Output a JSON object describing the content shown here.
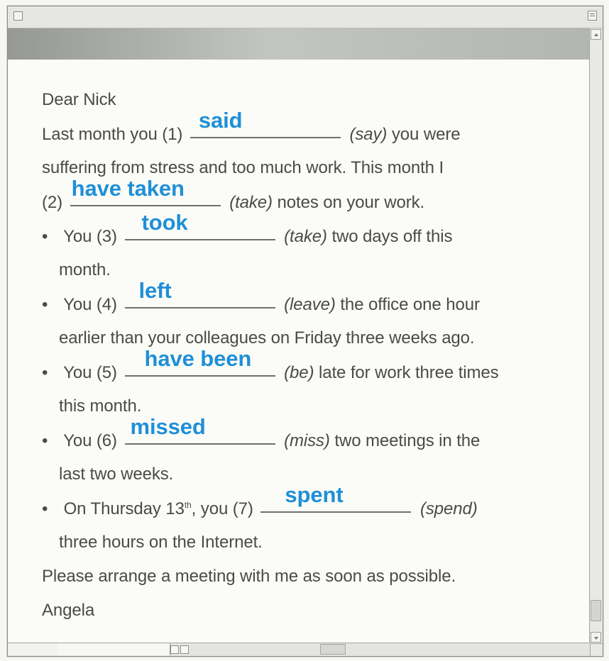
{
  "window": {
    "controls": {
      "close_icon": "close-box-icon",
      "collapse_icon": "collapse-box-icon"
    }
  },
  "letter": {
    "greeting": "Dear Nick",
    "line1_prefix": "Last month you (1)",
    "answer1": "said",
    "line1_hint": "(say)",
    "line1_suffix": "you were",
    "line2": "suffering from stress and too much work. This month I",
    "line3_prefix": "(2)",
    "answer2": "have taken",
    "line3_hint": "(take)",
    "line3_suffix": "notes on your work.",
    "bullet1_prefix": "You (3)",
    "answer3": "took",
    "bullet1_hint": "(take)",
    "bullet1_suffix": "two days off this",
    "bullet1_cont": "month.",
    "bullet2_prefix": "You (4)",
    "answer4": "left",
    "bullet2_hint": "(leave)",
    "bullet2_suffix": "the office one hour",
    "bullet2_cont": "earlier than your colleagues on Friday three weeks ago.",
    "bullet3_prefix": "You (5)",
    "answer5": "have been",
    "bullet3_hint": "(be)",
    "bullet3_suffix": "late for work three times",
    "bullet3_cont": "this month.",
    "bullet4_prefix": "You (6)",
    "answer6": "missed",
    "bullet4_hint": "(miss)",
    "bullet4_suffix": "two meetings in the",
    "bullet4_cont": "last two weeks.",
    "bullet5_prefix": "On Thursday 13",
    "bullet5_sup": "th",
    "bullet5_mid": ", you (7)",
    "answer7": "spent",
    "bullet5_hint": "(spend)",
    "bullet5_cont": "three hours on the Internet.",
    "closing": "Please arrange a meeting with me as soon as possible.",
    "signature": "Angela"
  },
  "colors": {
    "answer": "#1f8fd7",
    "text": "#4a4a4a",
    "background": "#fbfcf8"
  }
}
